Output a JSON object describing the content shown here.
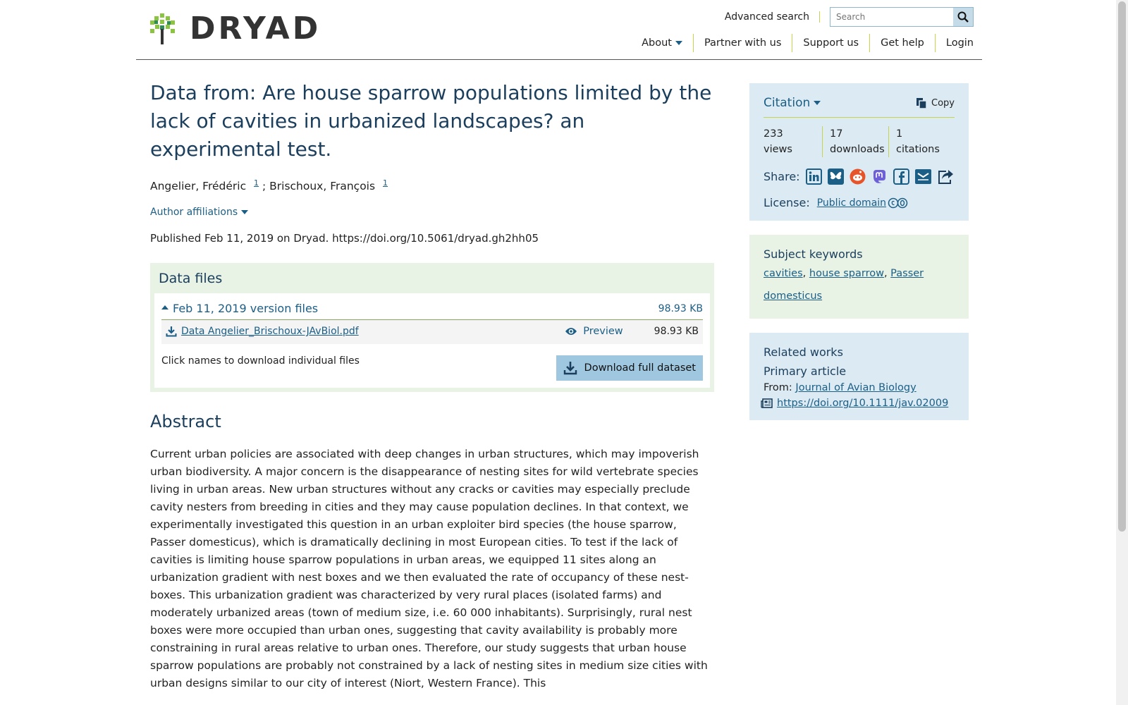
{
  "header": {
    "logo_text": "DRYAD",
    "advanced_search": "Advanced search",
    "search_placeholder": "Search",
    "nav": [
      "About",
      "Partner with us",
      "Support us",
      "Get help",
      "Login"
    ]
  },
  "dataset": {
    "title": "Data from: Are house sparrow populations limited by the lack of cavities in urbanized landscapes? an experimental test.",
    "authors": [
      {
        "name": "Angelier, Frédéric",
        "affil": "1"
      },
      {
        "name": "Brischoux, François",
        "affil": "1"
      }
    ],
    "author_sep": " ; ",
    "author_affiliations": "Author affiliations",
    "published": "Published Feb 11, 2019 on Dryad. https://doi.org/10.5061/dryad.gh2hh05"
  },
  "data_files": {
    "heading": "Data files",
    "version_label": "Feb 11, 2019 version files",
    "version_size": "98.93 KB",
    "file_name": "Data Angelier_Brischoux-JAvBiol.pdf",
    "preview_label": "Preview",
    "file_size": "98.93 KB",
    "hint": "Click names to download individual files",
    "download_full": "Download full dataset"
  },
  "abstract": {
    "heading": "Abstract",
    "text": "Current urban policies are associated with deep changes in urban structures, which may impoverish urban biodiversity. A major concern is the disappearance of nesting sites for wild vertebrate species living in urban areas. New urban structures without any cracks or cavities may especially preclude cavity nesters from breeding in cities and they may cause population declines. In that context, we experimentally investigated this question in an urban exploiter bird species (the house sparrow, Passer domesticus), which is dramatically declining in most European cities. To test if the lack of cavities is limiting house sparrow populations in urban areas, we equipped 11 sites along an urbanization gradient with nest boxes and we then evaluated the rate of occupancy of these nest-boxes. This urbanization gradient was characterized by very rural places (isolated farms) and moderately urbanized areas (town of medium size, i.e. 60 000 inhabitants). Surprisingly, rural nest boxes were more occupied than urban ones, suggesting that cavity availability is probably more constraining in rural areas relative to urban ones. Therefore, our study suggests that urban house sparrow populations are probably not constrained by a lack of nesting sites in medium size cities with urban designs similar to our city of interest (Niort, Western France). This"
  },
  "citation": {
    "title": "Citation",
    "copy": "Copy",
    "metrics": [
      {
        "value": "233",
        "label": "views"
      },
      {
        "value": "17",
        "label": "downloads"
      },
      {
        "value": "1",
        "label": "citations"
      }
    ],
    "share_label": "Share:",
    "license_label": "License:",
    "license_value": "Public domain"
  },
  "keywords": {
    "title": "Subject keywords",
    "items": [
      "cavities",
      "house sparrow",
      "Passer domesticus"
    ]
  },
  "related": {
    "title": "Related works",
    "subtitle": "Primary article",
    "from_label": "From:",
    "journal": "Journal of Avian Biology",
    "doi": "https://doi.org/10.1111/jav.02009"
  },
  "colors": {
    "accent": "#1b5e86",
    "heading": "#1a3e5c",
    "green_panel": "#e8f3e6",
    "blue_panel": "#dcebf3",
    "divider": "#c6d54b"
  }
}
